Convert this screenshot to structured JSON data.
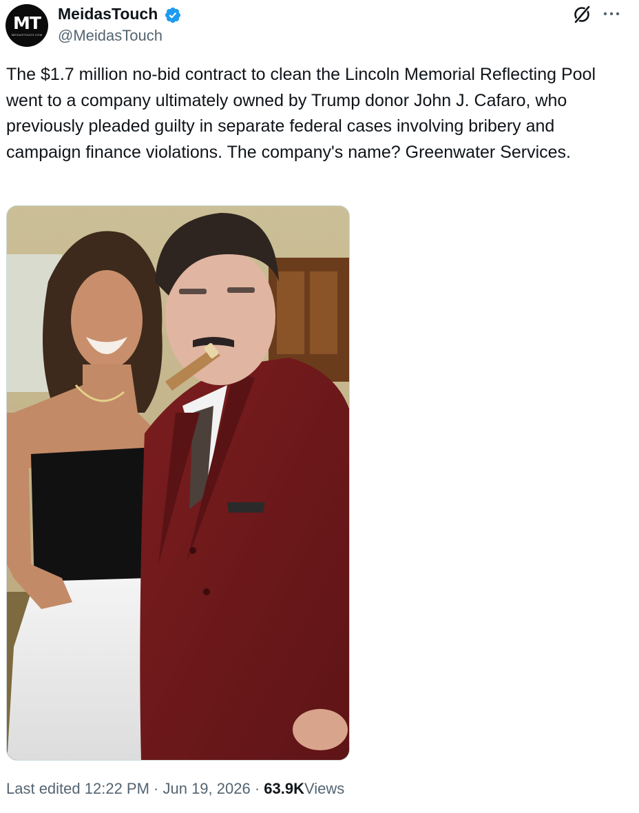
{
  "author": {
    "display_name": "MeidasTouch",
    "handle": "@MeidasTouch",
    "avatar_logo": "MT",
    "avatar_logo_sub": "MEIDASTOUCH.COM",
    "verified": true,
    "verified_color": "#1d9bf0"
  },
  "header_icons": {
    "grok": "grok-icon",
    "more": "more-icon"
  },
  "tweet": {
    "text": "The $1.7 million no-bid contract to clean the Lincoln Memorial Reflecting Pool went to a company ultimately owned by Trump donor John J. Cafaro, who previously pleaded guilty in separate federal cases involving bribery and campaign finance violations. The company's name? Greenwater Services."
  },
  "media": {
    "type": "photo"
  },
  "footer": {
    "edited_label": "Last edited",
    "time": "12:22 PM",
    "separator": "·",
    "date": "Jun 19, 2026",
    "views_count": "63.9K",
    "views_label": "Views"
  },
  "colors": {
    "text_primary": "#0f1419",
    "text_secondary": "#536471",
    "border": "#cfd9de",
    "accent": "#1d9bf0"
  }
}
